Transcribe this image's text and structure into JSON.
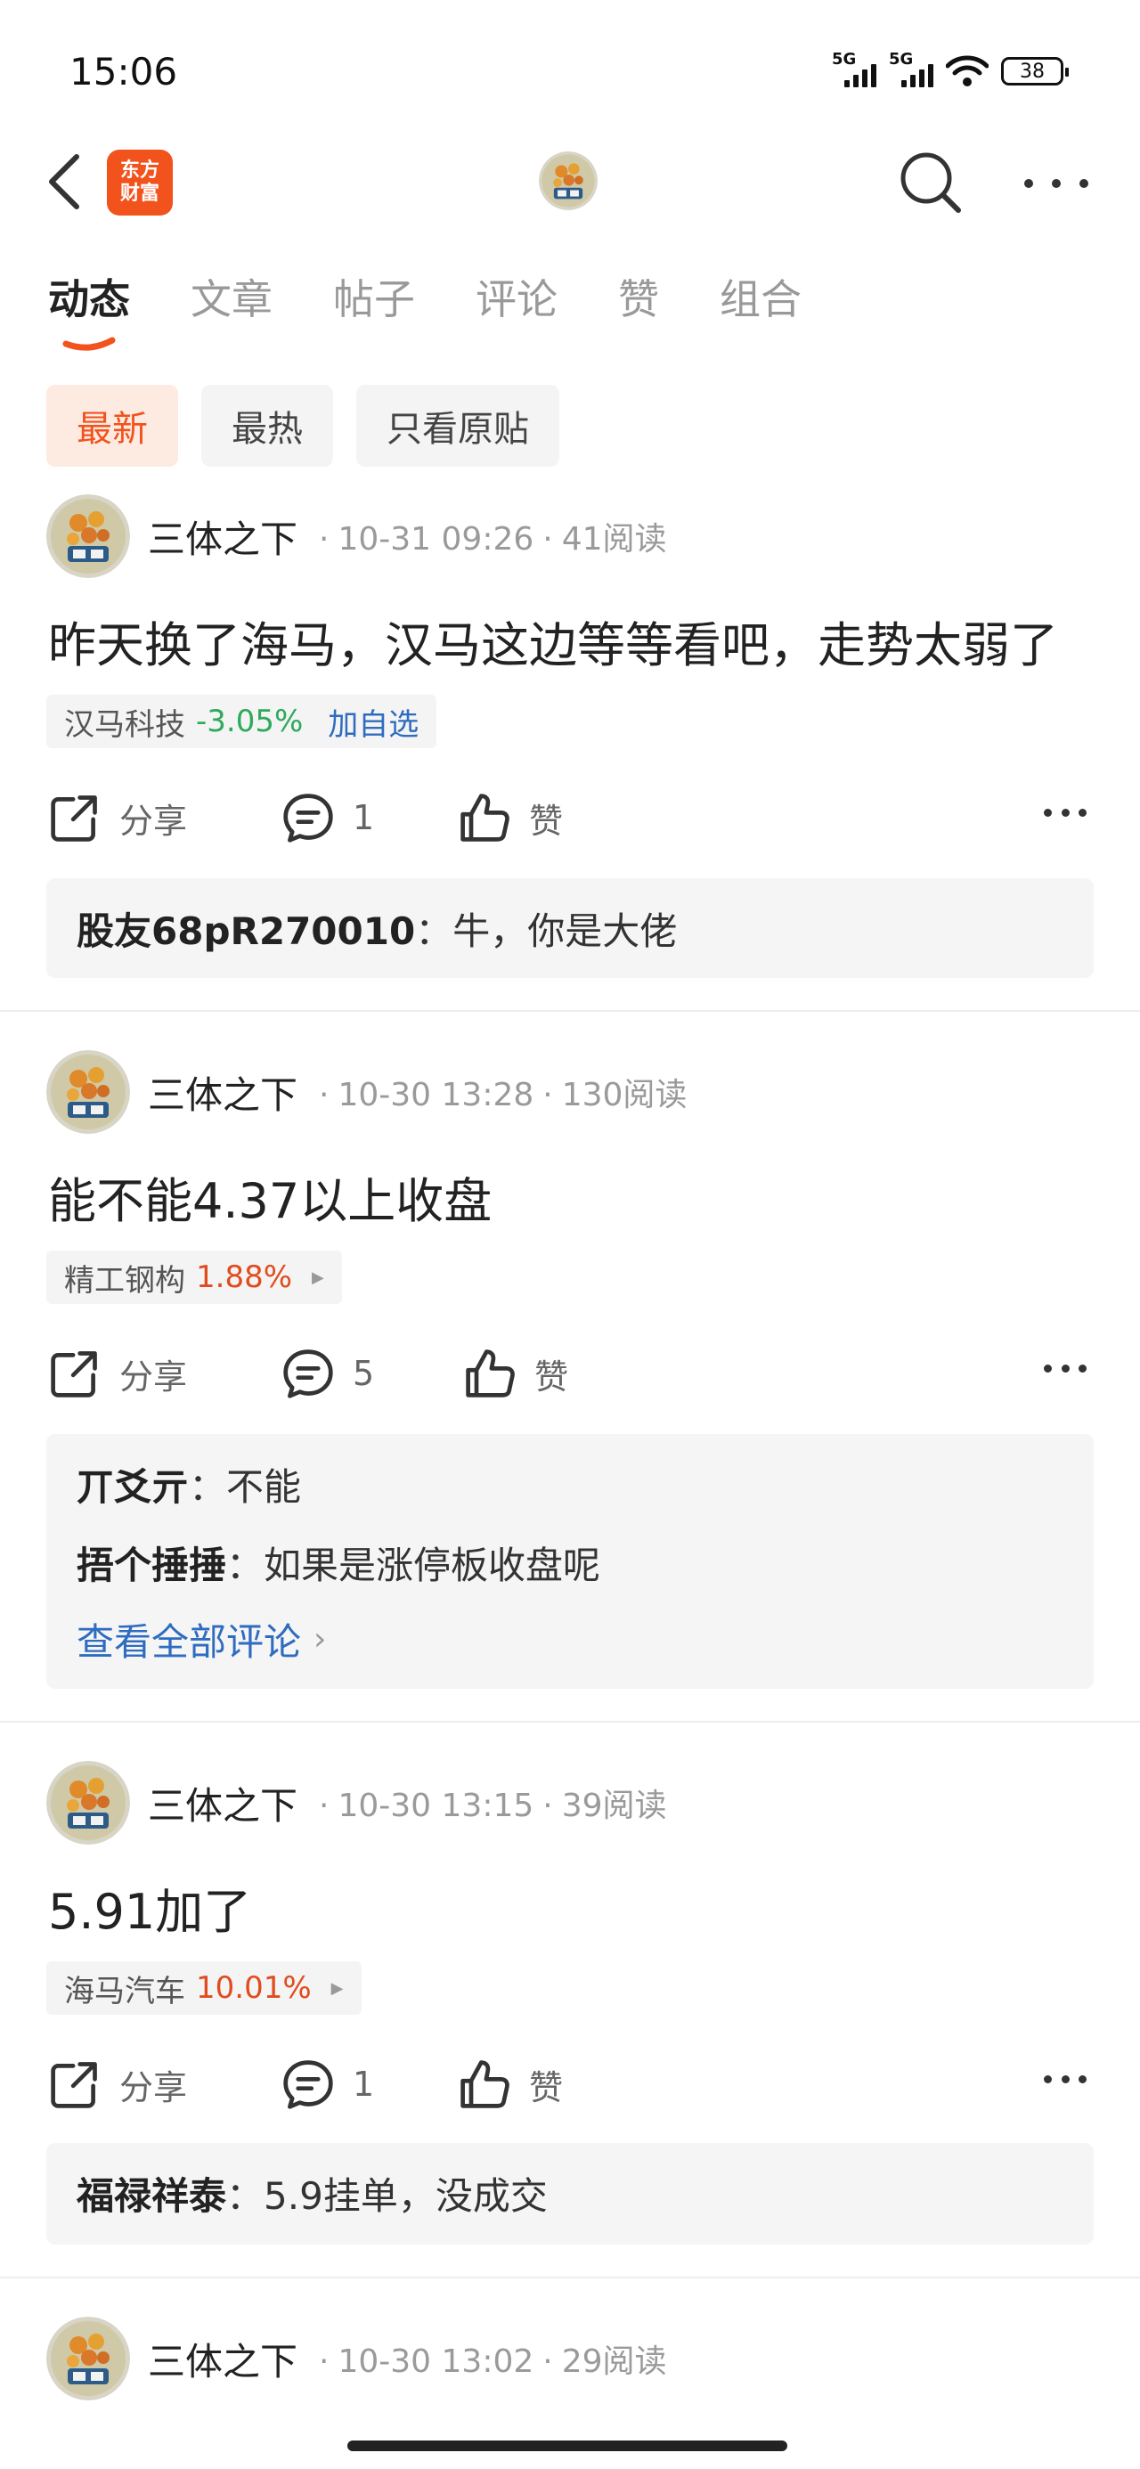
{
  "status_bar": {
    "time": "15:06",
    "network1": "5G",
    "network2": "5G",
    "battery": "38"
  },
  "header": {
    "logo_line1": "东方",
    "logo_line2": "财富"
  },
  "tabs": [
    {
      "label": "动态",
      "active": true
    },
    {
      "label": "文章",
      "active": false
    },
    {
      "label": "帖子",
      "active": false
    },
    {
      "label": "评论",
      "active": false
    },
    {
      "label": "赞",
      "active": false
    },
    {
      "label": "组合",
      "active": false
    }
  ],
  "filters": [
    {
      "label": "最新",
      "active": true
    },
    {
      "label": "最热",
      "active": false
    },
    {
      "label": "只看原贴",
      "active": false
    }
  ],
  "posts": [
    {
      "author": "三体之下",
      "sep": "·",
      "time": "10-31 09:26",
      "reads": "41阅读",
      "text": "昨天换了海马，汉马这边等等看吧，走势太弱了",
      "stock": {
        "name": "汉马科技",
        "change": "-3.05%",
        "extra": "加自选"
      },
      "share_label": "分享",
      "comment_count": "1",
      "like_label": "赞",
      "comments": [
        {
          "user": "股友68pR270010",
          "colon": "：",
          "text": "牛，你是大佬"
        }
      ]
    },
    {
      "author": "三体之下",
      "sep": "·",
      "time": "10-30 13:28",
      "reads": "130阅读",
      "text": "能不能4.37以上收盘",
      "stock": {
        "name": "精工钢构",
        "change": "1.88%"
      },
      "share_label": "分享",
      "comment_count": "5",
      "like_label": "赞",
      "comments": [
        {
          "user": "丌爻亓",
          "colon": "：",
          "text": "不能"
        },
        {
          "user": "捂个捶捶",
          "colon": "：",
          "text": "如果是涨停板收盘呢"
        }
      ],
      "view_all": "查看全部评论"
    },
    {
      "author": "三体之下",
      "sep": "·",
      "time": "10-30 13:15",
      "reads": "39阅读",
      "text": "5.91加了",
      "stock": {
        "name": "海马汽车",
        "change": "10.01%"
      },
      "share_label": "分享",
      "comment_count": "1",
      "like_label": "赞",
      "comments": [
        {
          "user": "福禄祥泰",
          "colon": "：",
          "text": "5.9挂单，没成交"
        }
      ]
    },
    {
      "author": "三体之下",
      "sep": "·",
      "time": "10-30 13:02",
      "reads": "29阅读"
    }
  ],
  "colors": {
    "accent": "#f2521c",
    "link": "#2f6cc0",
    "down": "#2eaa5b",
    "up": "#e04c1e"
  },
  "icons": [
    "back-icon",
    "search-icon",
    "more-icon",
    "share-icon",
    "comment-icon",
    "like-icon"
  ]
}
